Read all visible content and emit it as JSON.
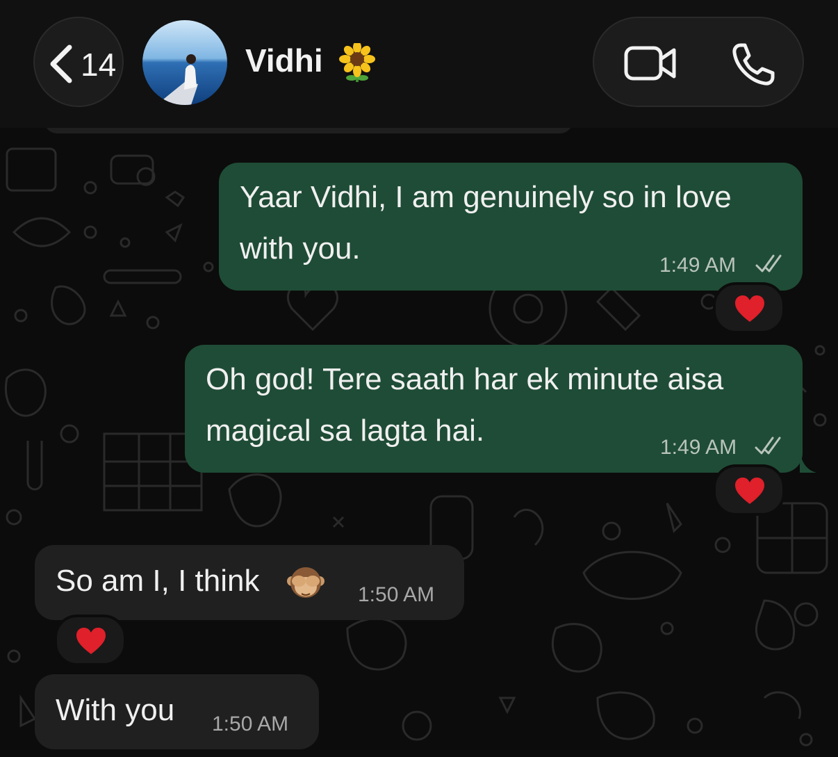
{
  "header": {
    "back_count": "14",
    "contact_name": "Vidhi",
    "name_emoji_icon": "sunflower-icon",
    "video_icon": "video-camera-icon",
    "call_icon": "phone-icon"
  },
  "messages": [
    {
      "direction": "outgoing",
      "text": "Yaar Vidhi, I am genuinely so in love\nwith you.",
      "time": "1:49 AM",
      "status": "read-double-check",
      "reaction": "red-heart"
    },
    {
      "direction": "outgoing",
      "text": "Oh god! Tere saath har ek minute aisa\nmagical sa lagta hai.",
      "time": "1:49 AM",
      "status": "read-double-check",
      "reaction": "red-heart"
    },
    {
      "direction": "incoming",
      "text": "So am I, I think",
      "emoji": "see-no-evil-monkey",
      "time": "1:50 AM",
      "reaction": "red-heart"
    },
    {
      "direction": "incoming",
      "text": "With you",
      "time": "1:50 AM"
    }
  ],
  "colors": {
    "outgoing_bubble": "#1f4c36",
    "incoming_bubble": "#202020",
    "background": "#0c0c0c",
    "heart": "#e0202a"
  }
}
